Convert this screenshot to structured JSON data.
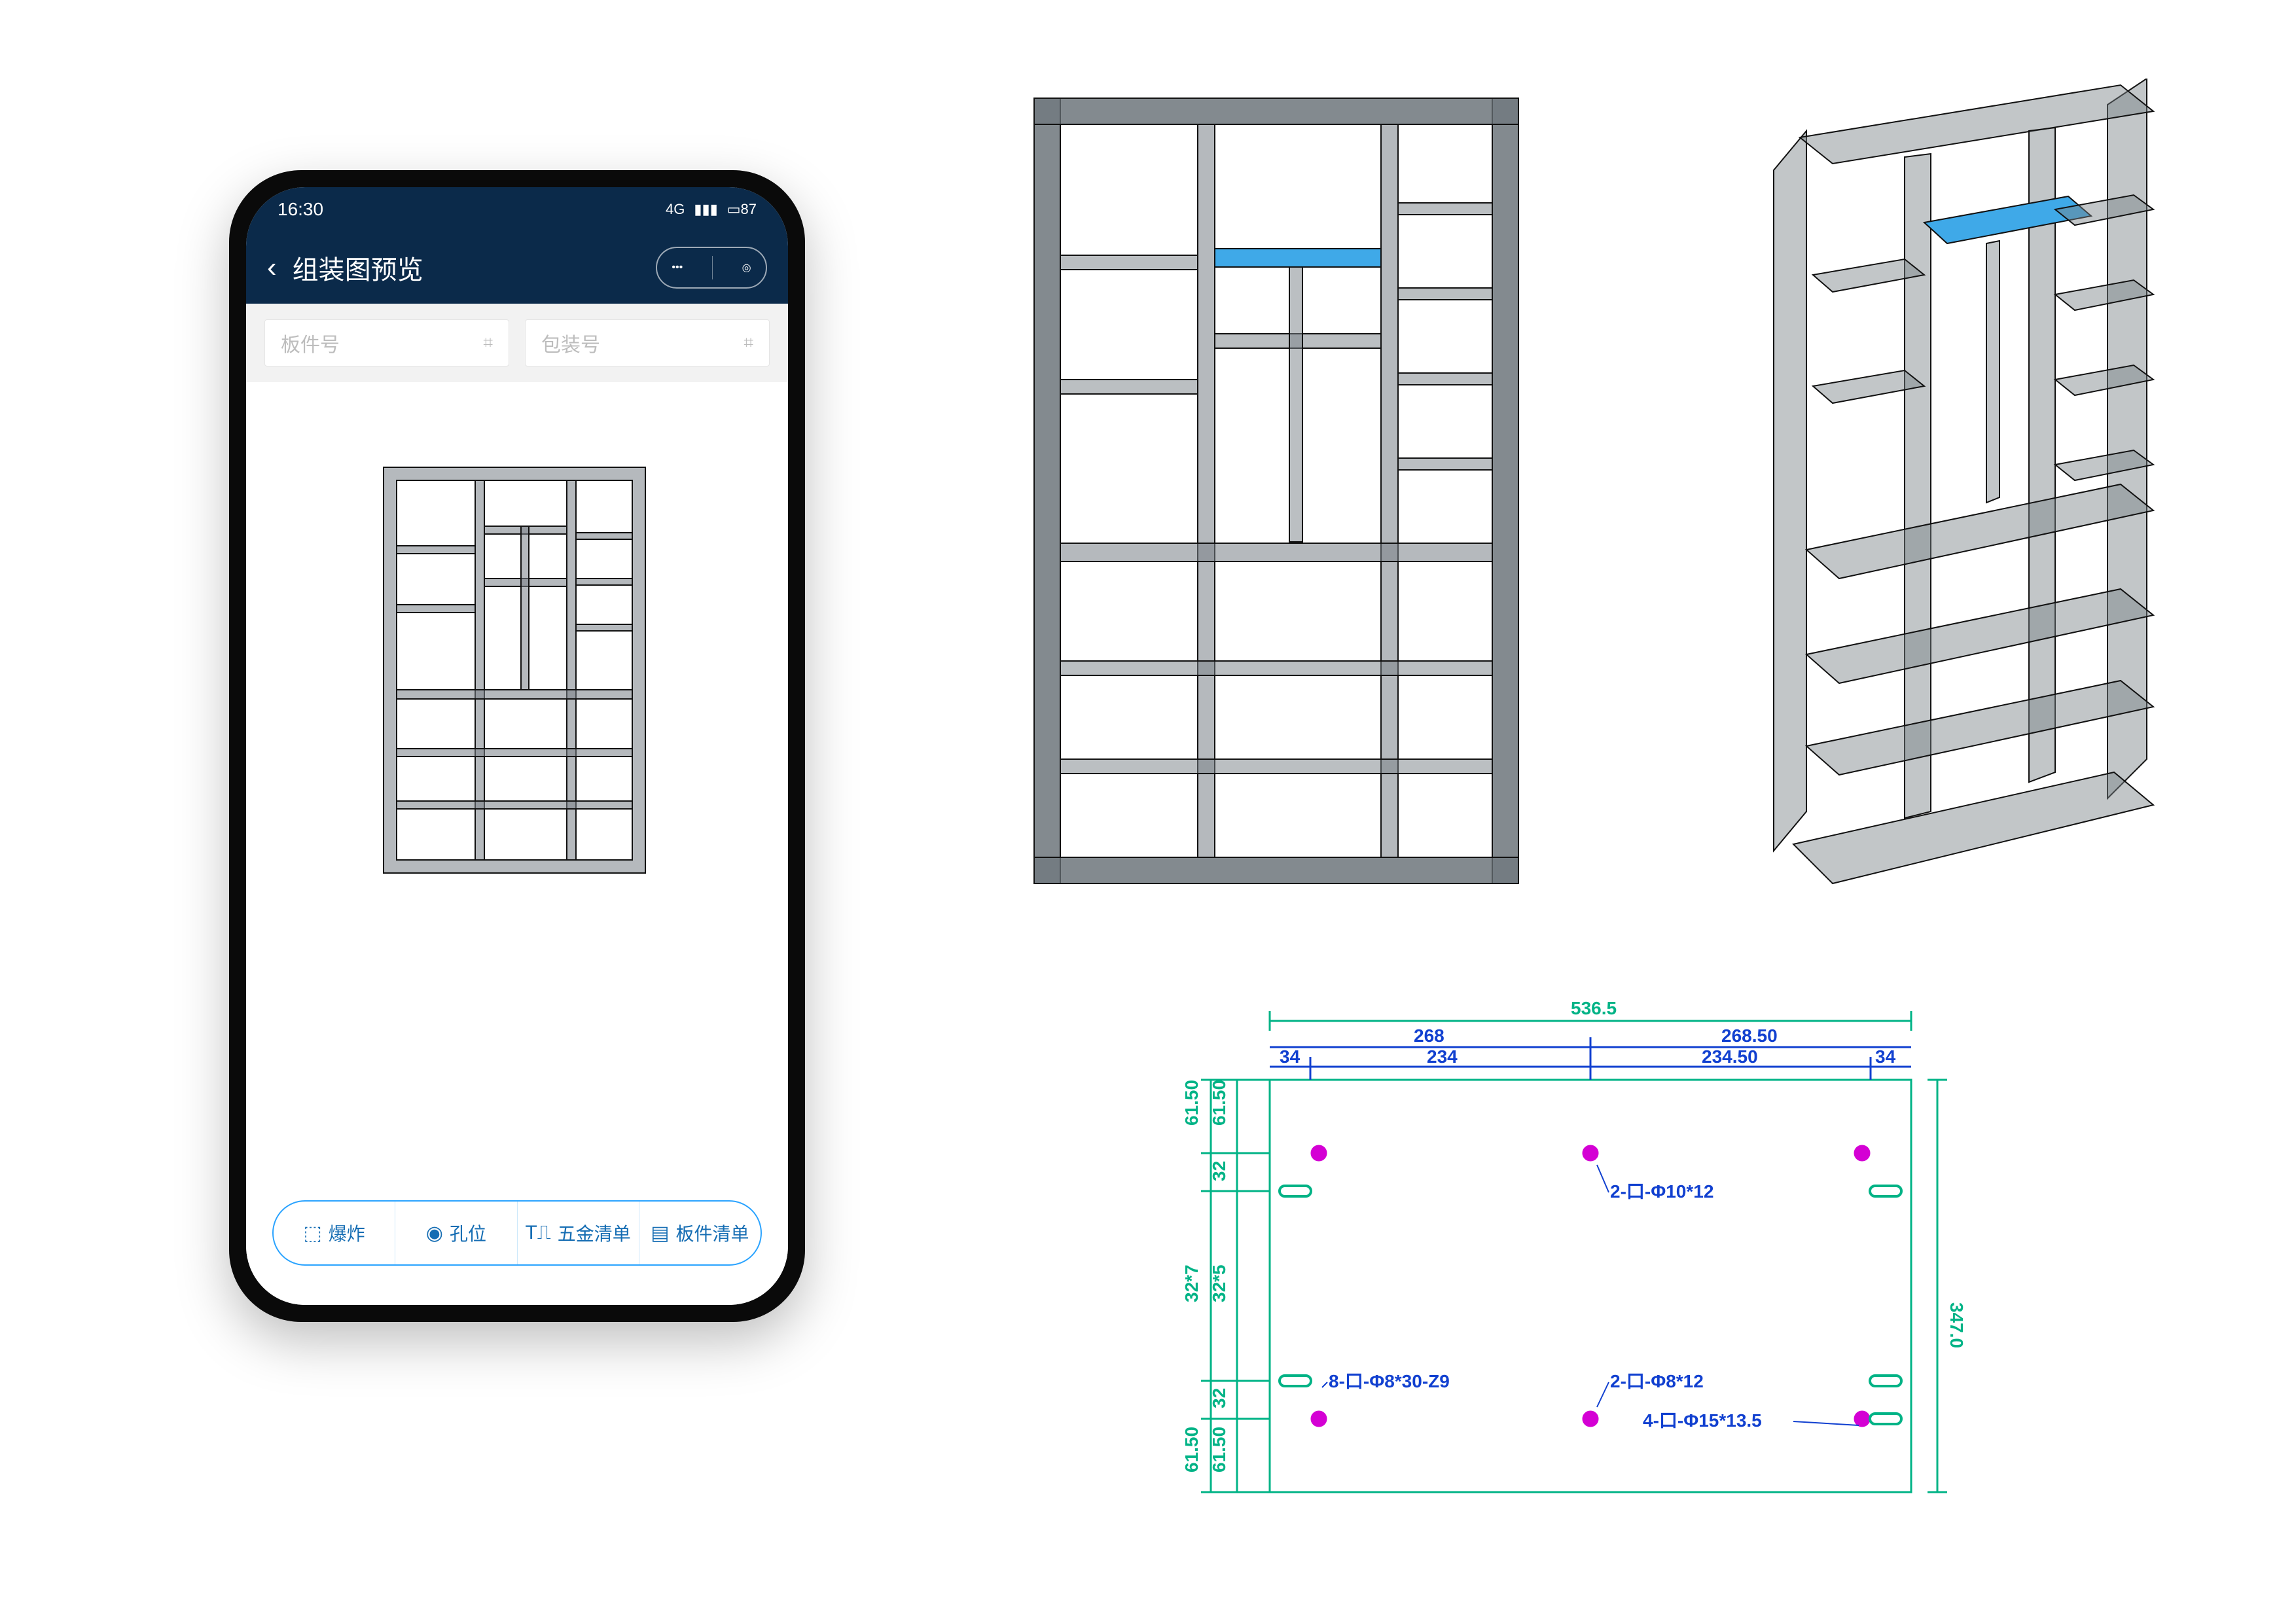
{
  "phone": {
    "clock": "16:30",
    "network": "4G",
    "battery": "87",
    "title": "组装图预览",
    "filters": {
      "panel_no_placeholder": "板件号",
      "package_no_placeholder": "包装号"
    },
    "toolbar": {
      "explode": "爆炸",
      "holes": "孔位",
      "hardware": "五金清单",
      "panels": "板件清单"
    }
  },
  "cabinets": {
    "highlight_color": "#3fa9e8",
    "body_color": "#9aa1a6"
  },
  "drawing": {
    "top_total": "536.5",
    "top_half_left": "268",
    "top_half_right": "268.50",
    "top_inset_left": "234",
    "top_inset_right": "234.50",
    "top_edge_left": "34",
    "top_edge_right": "34",
    "side_total": "347.0",
    "side_step1": "61.50",
    "side_step1b": "61.50",
    "side_step2": "32",
    "side_mid": "32*7",
    "side_midb": "32*5",
    "side_step3": "32",
    "side_step4": "61.50",
    "side_step4b": "61.50",
    "ann_phi10": "2-口-Φ10*12",
    "ann_phi8_12": "2-口-Φ8*12",
    "ann_phi15": "4-口-Φ15*13.5",
    "ann_phi8_30": "8-口-Φ8*30-Z9",
    "dim_color": "#00b386",
    "ann_color": "#1140d0",
    "hole_color": "#d400d4"
  }
}
